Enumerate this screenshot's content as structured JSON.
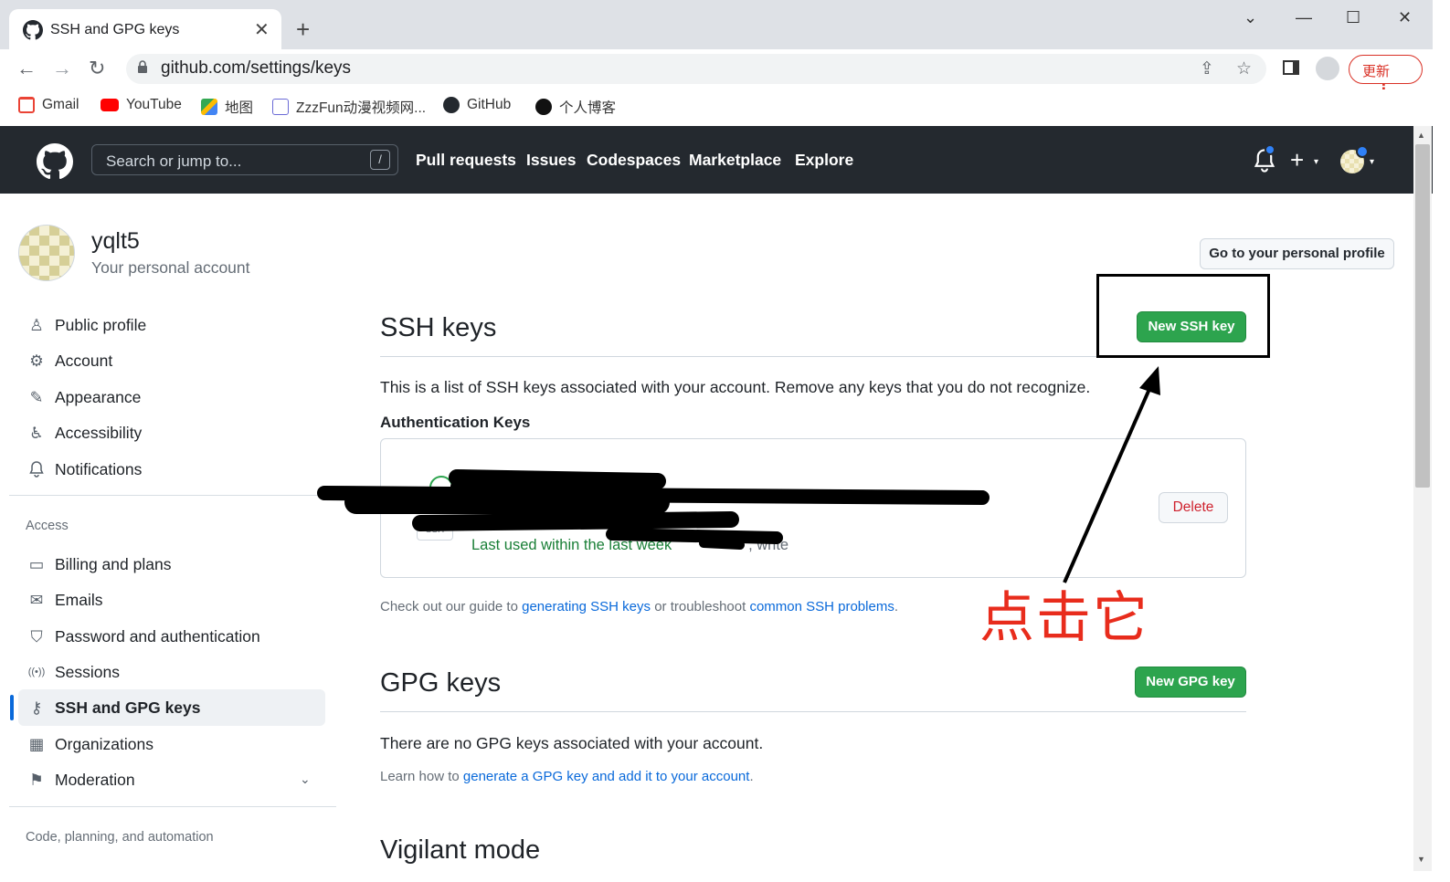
{
  "browser": {
    "tab_title": "SSH and GPG keys",
    "tab_close": "✕",
    "new_tab": "+",
    "window_controls": [
      "⌄",
      "—",
      "☐",
      "✕"
    ],
    "nav": {
      "back": "←",
      "forward": "→",
      "reload": "↻"
    },
    "url": "github.com/settings/keys",
    "update_label": "更新",
    "update_menu": "⋮",
    "bookmarks": [
      {
        "label": "Gmail",
        "icon": "gmail-icon",
        "color": "#ea4335"
      },
      {
        "label": "YouTube",
        "icon": "youtube-icon",
        "color": "#ff0000"
      },
      {
        "label": "地图",
        "icon": "maps-icon",
        "color": "#34a853"
      },
      {
        "label": "ZzzFun动漫视频网...",
        "icon": "zzzfun-icon",
        "color": "#6b6bd6"
      },
      {
        "label": "GitHub",
        "icon": "github-icon",
        "color": "#24292f"
      },
      {
        "label": "个人博客",
        "icon": "blog-icon",
        "color": "#111111"
      }
    ]
  },
  "github_header": {
    "search_placeholder": "Search or jump to...",
    "search_shortcut": "/",
    "nav": [
      "Pull requests",
      "Issues",
      "Codespaces",
      "Marketplace",
      "Explore"
    ],
    "plus": "+",
    "caret": "▾"
  },
  "sidebar": {
    "username": "yqlt5",
    "subtitle": "Your personal account",
    "items_top": [
      {
        "label": "Public profile",
        "icon": "person-icon",
        "glyph": "♙"
      },
      {
        "label": "Account",
        "icon": "gear-icon",
        "glyph": "⚙"
      },
      {
        "label": "Appearance",
        "icon": "paintbrush-icon",
        "glyph": "✎"
      },
      {
        "label": "Accessibility",
        "icon": "accessibility-icon",
        "glyph": "♿"
      },
      {
        "label": "Notifications",
        "icon": "bell-icon",
        "glyph": "🔔"
      }
    ],
    "access_heading": "Access",
    "items_access": [
      {
        "label": "Billing and plans",
        "icon": "credit-card-icon",
        "glyph": "▭"
      },
      {
        "label": "Emails",
        "icon": "mail-icon",
        "glyph": "✉"
      },
      {
        "label": "Password and authentication",
        "icon": "shield-lock-icon",
        "glyph": "⛉"
      },
      {
        "label": "Sessions",
        "icon": "broadcast-icon",
        "glyph": "((•))"
      },
      {
        "label": "SSH and GPG keys",
        "icon": "key-icon",
        "glyph": "⚷",
        "active": true
      },
      {
        "label": "Organizations",
        "icon": "organization-icon",
        "glyph": "▦"
      },
      {
        "label": "Moderation",
        "icon": "report-icon",
        "glyph": "⚑"
      }
    ],
    "moderation_caret": "⌄",
    "code_heading": "Code, planning, and automation"
  },
  "main": {
    "profile_button": "Go to your personal profile",
    "ssh": {
      "title": "SSH keys",
      "new_button": "New SSH key",
      "description": "This is a list of SSH keys associated with your account. Remove any keys that you do not recognize.",
      "auth_title": "Authentication Keys",
      "key_badge": "SSH",
      "key_last_used": "Last used within the last week",
      "key_last_used_suffix": "— , write",
      "delete_label": "Delete",
      "guide_prefix": "Check out our guide to ",
      "guide_link1": "generating SSH keys",
      "guide_mid": " or troubleshoot ",
      "guide_link2": "common SSH problems",
      "guide_suffix": "."
    },
    "gpg": {
      "title": "GPG keys",
      "new_button": "New GPG key",
      "empty": "There are no GPG keys associated with your account.",
      "learn_prefix": "Learn how to ",
      "learn_link": "generate a GPG key and add it to your account",
      "learn_suffix": "."
    },
    "vigilant_title": "Vigilant mode"
  },
  "annotation": {
    "text": "点击它"
  }
}
